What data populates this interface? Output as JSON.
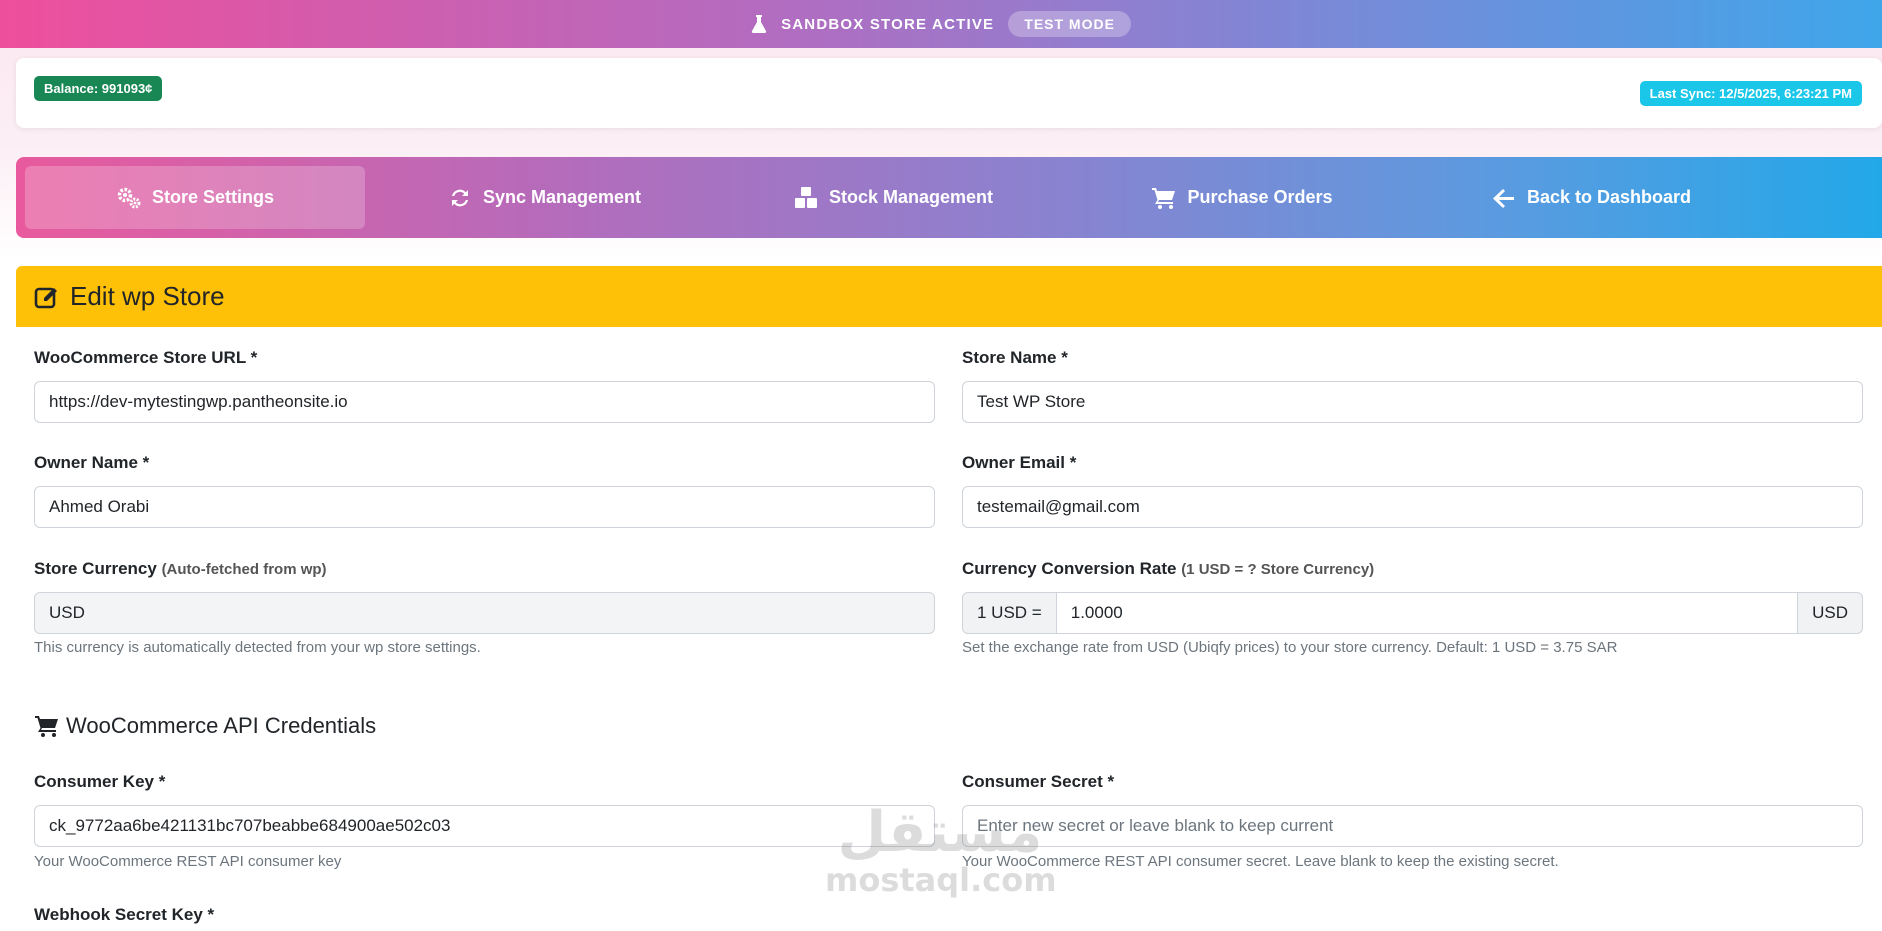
{
  "banner": {
    "sandbox_text": "SANDBOX STORE ACTIVE",
    "mode_pill": "TEST MODE",
    "flask_icon": "flask-icon"
  },
  "info": {
    "balance": "Balance: 991093¢",
    "last_sync": "Last Sync: 12/5/2025, 6:23:21 PM",
    "balance_color": "#198754",
    "sync_color": "#1bc7e8"
  },
  "nav": {
    "items": [
      {
        "label": "Store Settings",
        "icon": "cogs-icon",
        "active": true
      },
      {
        "label": "Sync Management",
        "icon": "sync-icon",
        "active": false
      },
      {
        "label": "Stock Management",
        "icon": "cubes-icon",
        "active": false
      },
      {
        "label": "Purchase Orders",
        "icon": "cart-icon",
        "active": false
      },
      {
        "label": "Back to Dashboard",
        "icon": "arrow-left-icon",
        "active": false
      }
    ]
  },
  "form": {
    "title": "Edit wp Store",
    "header_color": "#ffc107",
    "store_url": {
      "label": "WooCommerce Store URL *",
      "value": "https://dev-mytestingwp.pantheonsite.io"
    },
    "store_name": {
      "label": "Store Name *",
      "value": "Test WP Store"
    },
    "owner_name": {
      "label": "Owner Name *",
      "value": "Ahmed Orabi"
    },
    "owner_email": {
      "label": "Owner Email *",
      "value": "testemail@gmail.com"
    },
    "currency": {
      "label": "Store Currency",
      "hint": "(Auto-fetched from wp)",
      "value": "USD",
      "help": "This currency is automatically detected from your wp store settings."
    },
    "conversion": {
      "label": "Currency Conversion Rate",
      "hint": "(1 USD = ? Store Currency)",
      "prefix": "1 USD =",
      "value": "1.0000",
      "suffix": "USD",
      "help": "Set the exchange rate from USD (Ubiqfy prices) to your store currency. Default: 1 USD = 3.75 SAR"
    },
    "api_section": "WooCommerce API Credentials",
    "consumer_key": {
      "label": "Consumer Key *",
      "value": "ck_9772aa6be421131bc707beabbe684900ae502c03",
      "help": "Your WooCommerce REST API consumer key"
    },
    "consumer_secret": {
      "label": "Consumer Secret *",
      "placeholder": "Enter new secret or leave blank to keep current",
      "help": "Your WooCommerce REST API consumer secret. Leave blank to keep the existing secret."
    },
    "webhook": {
      "label": "Webhook Secret Key *"
    }
  },
  "watermark": {
    "arabic": "مستقل",
    "latin": "mostaql.com"
  }
}
